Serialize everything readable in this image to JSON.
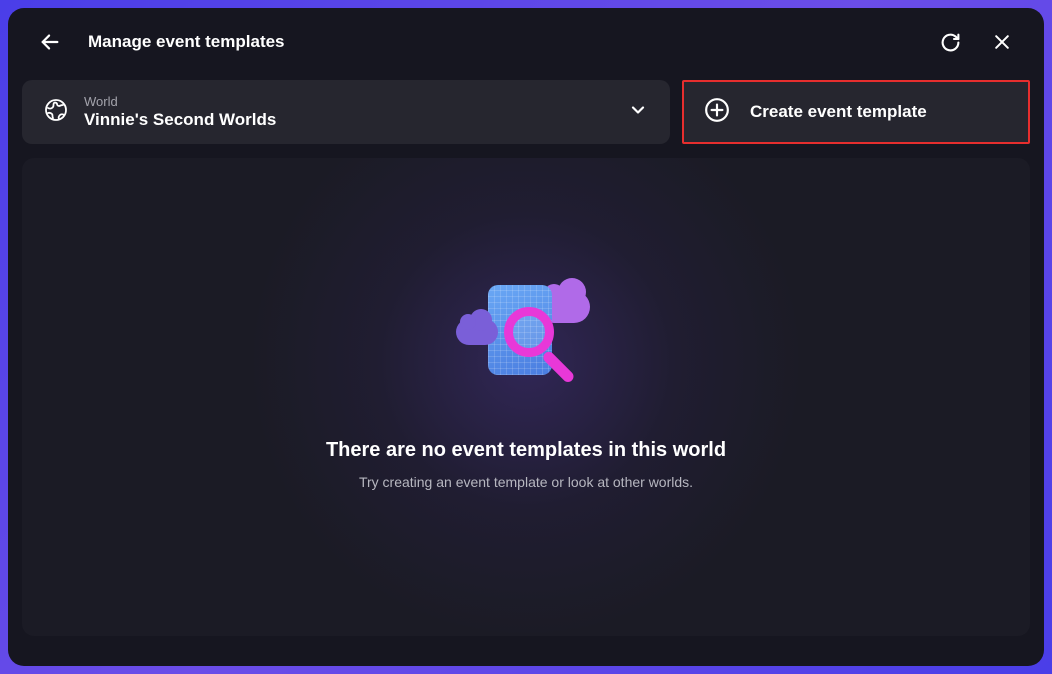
{
  "header": {
    "title": "Manage event templates"
  },
  "worldSelector": {
    "label": "World",
    "value": "Vinnie's Second Worlds"
  },
  "createButton": {
    "label": "Create event template"
  },
  "empty": {
    "title": "There are no event templates in this world",
    "subtitle": "Try creating an event template or look at other worlds."
  }
}
